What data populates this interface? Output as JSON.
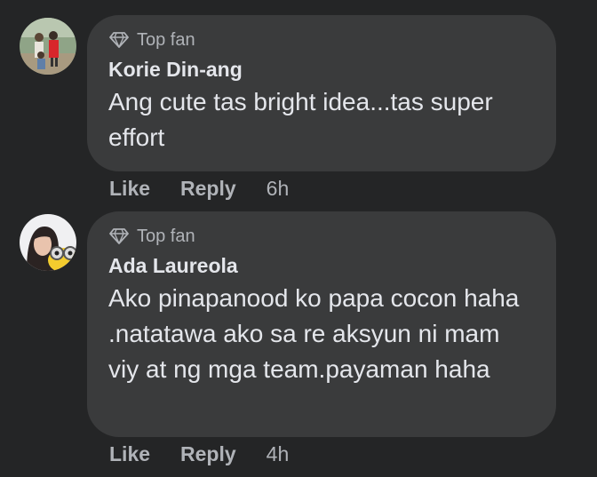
{
  "comments": [
    {
      "badge": "Top fan",
      "author": "Korie Din-ang",
      "text": "Ang cute tas bright idea...tas super effort",
      "like": "Like",
      "reply": "Reply",
      "time": "6h"
    },
    {
      "badge": "Top fan",
      "author": "Ada Laureola",
      "text": "Ako pinapanood ko papa cocon haha .natatawa ako sa re aksyun ni mam viy at ng mga team.payaman haha",
      "like": "Like",
      "reply": "Reply",
      "time": "4h"
    }
  ],
  "colors": {
    "background": "#242526",
    "bubble": "#3a3b3c",
    "primary_text": "#e4e6eb",
    "secondary_text": "#b0b3b8"
  }
}
